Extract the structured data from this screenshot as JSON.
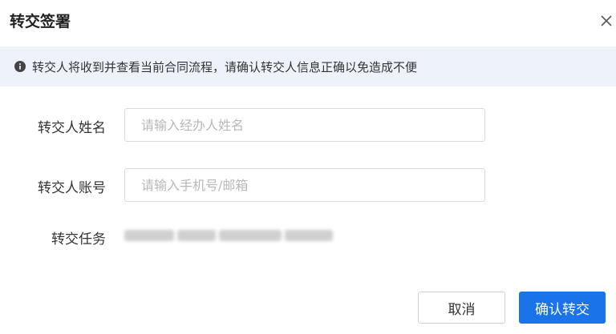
{
  "dialog": {
    "title": "转交签署",
    "close_icon": "close-icon"
  },
  "notice": {
    "icon": "info-icon",
    "text": "转交人将收到并查看当前合同流程，请确认转交人信息正确以免造成不便"
  },
  "form": {
    "name_label": "转交人姓名",
    "name_placeholder": "请输入经办人姓名",
    "name_value": "",
    "account_label": "转交人账号",
    "account_placeholder": "请输入手机号/邮箱",
    "account_value": "",
    "task_label": "转交任务"
  },
  "actions": {
    "cancel_label": "取消",
    "confirm_label": "确认转交"
  },
  "colors": {
    "primary": "#1a73e8",
    "notice_bg": "#eef3fb"
  }
}
